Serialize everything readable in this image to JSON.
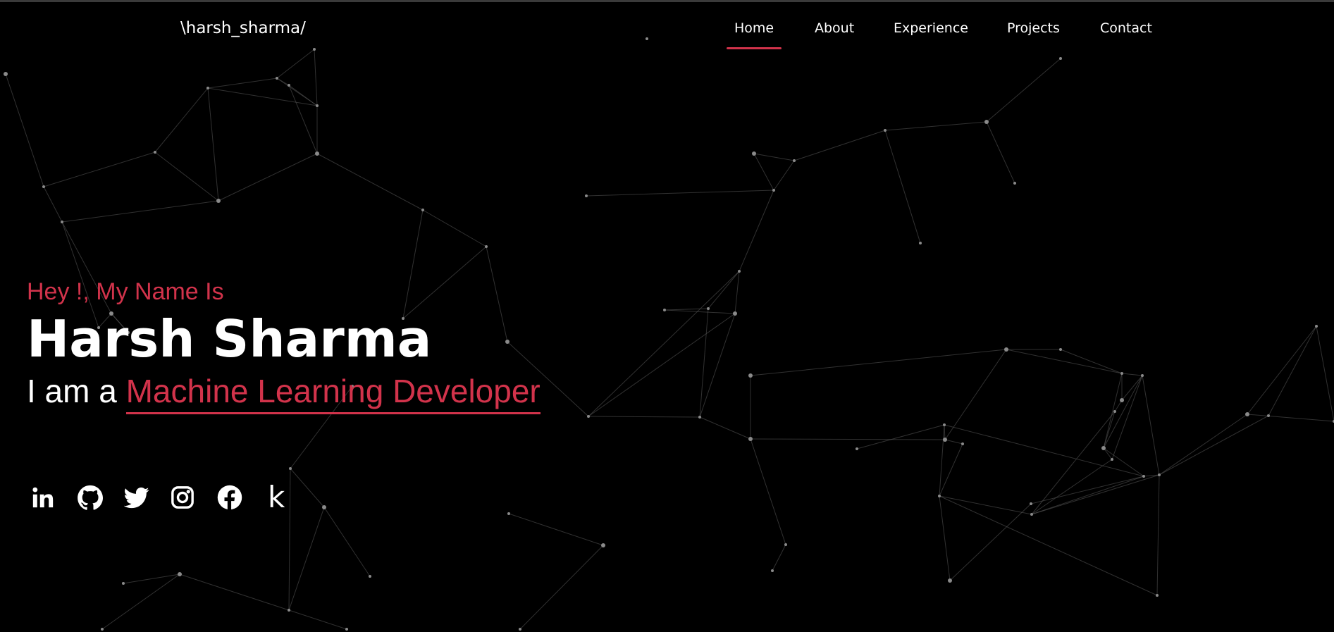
{
  "header": {
    "logo": "\\harsh_sharma/",
    "nav": [
      {
        "label": "Home",
        "active": true
      },
      {
        "label": "About",
        "active": false
      },
      {
        "label": "Experience",
        "active": false
      },
      {
        "label": "Projects",
        "active": false
      },
      {
        "label": "Contact",
        "active": false
      }
    ]
  },
  "hero": {
    "greeting": "Hey !, My Name Is",
    "name": "Harsh Sharma",
    "role_prefix": "I am a",
    "role_typed": "Machine Learning Developer"
  },
  "socials": [
    {
      "icon": "linkedin-icon"
    },
    {
      "icon": "github-icon"
    },
    {
      "icon": "twitter-icon"
    },
    {
      "icon": "instagram-icon"
    },
    {
      "icon": "facebook-icon"
    },
    {
      "icon": "kaggle-icon",
      "glyph": "k"
    }
  ],
  "colors": {
    "background": "#000000",
    "accent": "#d2334b",
    "text": "#ffffff",
    "network_line": "#5a5a5a",
    "network_node": "#8a8a8a"
  }
}
